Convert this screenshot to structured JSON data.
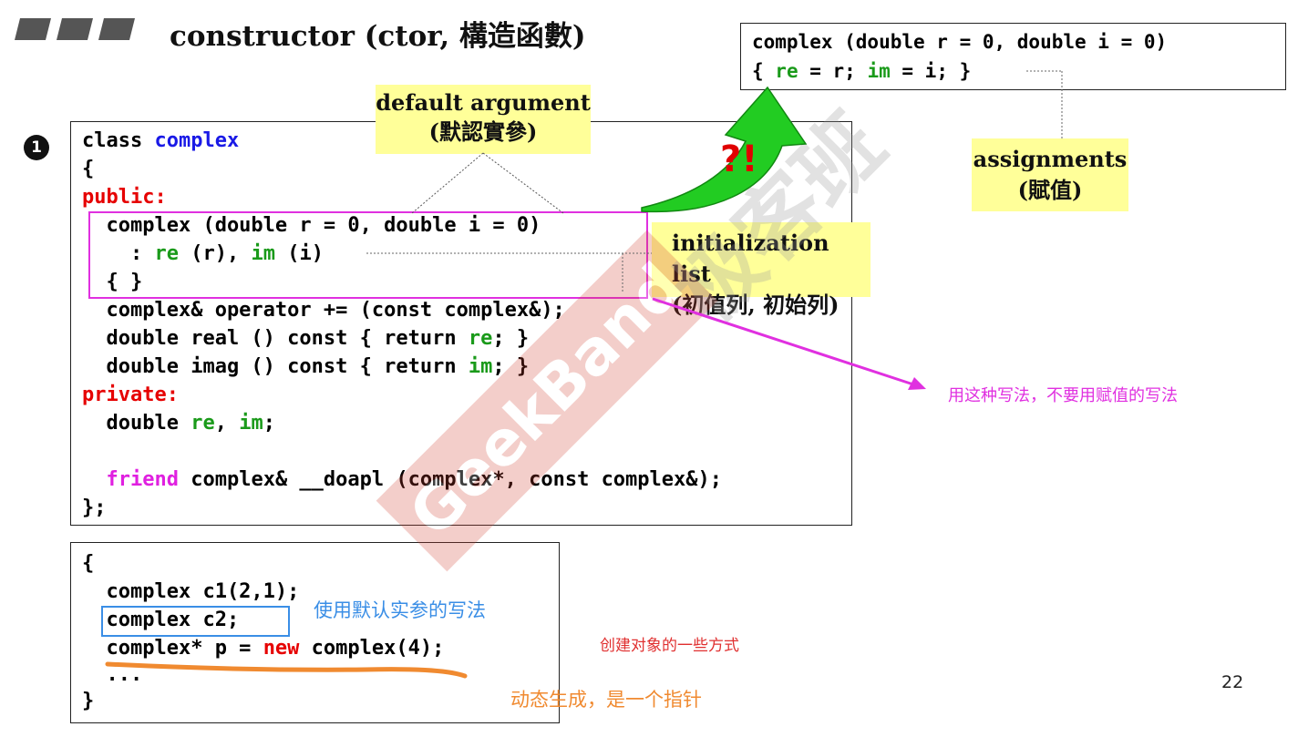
{
  "slide": {
    "title": "constructor (ctor, 構造函數)",
    "page_number": "22",
    "bullet_number": "1"
  },
  "top_code": {
    "line1": "complex (double r = 0, double i = 0)",
    "line2_parts": [
      "{ ",
      "re",
      " = r; ",
      "im",
      " = i; }"
    ]
  },
  "class_code": {
    "l1a": "class ",
    "l1b": "complex",
    "l2": "{",
    "l3": "public:",
    "l4": "  complex (double r = 0, double i = 0)",
    "l5a": "    : ",
    "l5b": "re",
    "l5c": " (r), ",
    "l5d": "im",
    "l5e": " (i)",
    "l6": "  { }",
    "l7": "  complex& operator += (const complex&);",
    "l8a": "  double real () const { return ",
    "l8b": "re",
    "l8c": "; }",
    "l9a": "  double imag () const { return ",
    "l9b": "im",
    "l9c": "; }",
    "l10": "private:",
    "l11a": "  double ",
    "l11b": "re",
    "l11c": ", ",
    "l11d": "im",
    "l11e": ";",
    "l12a": "  ",
    "l12b": "friend",
    "l12c": " complex& __doapl (complex*, const complex&);",
    "l13": "};"
  },
  "usage_code": {
    "l1": "{",
    "l2": "  complex c1(2,1);",
    "l3": "  complex c2;",
    "l4a": "  complex* p = ",
    "l4b": "new",
    "l4c": " complex(4);",
    "l5": "  ...",
    "l6": "}"
  },
  "callouts": {
    "default_argument": "default argument",
    "default_argument_cn": "(默認實參)",
    "initialization_list": "initialization list",
    "initialization_list_cn": "(初值列, 初始列)",
    "assignments": "assignments",
    "assignments_cn": "(賦值)",
    "arrow_mark": "?!"
  },
  "notes": {
    "use_this_style": "用这种写法，不要用赋值的写法",
    "default_arg_style": "使用默认实参的写法",
    "ways_to_create": "创建对象的一些方式",
    "dynamic_pointer": "动态生成，是一个指针"
  },
  "watermark": {
    "brand": "GeekBand",
    "cn": "极客班"
  },
  "colors": {
    "keyword_blue": "#1a1ae6",
    "keyword_red": "#e60000",
    "member_green": "#1a9a1a",
    "friend_magenta": "#e020e0",
    "callout_yellow": "#ffff99",
    "highlight_magenta": "#e030e0",
    "note_blue": "#3a8ee6",
    "note_red": "#e03030",
    "note_orange": "#f08a30"
  }
}
